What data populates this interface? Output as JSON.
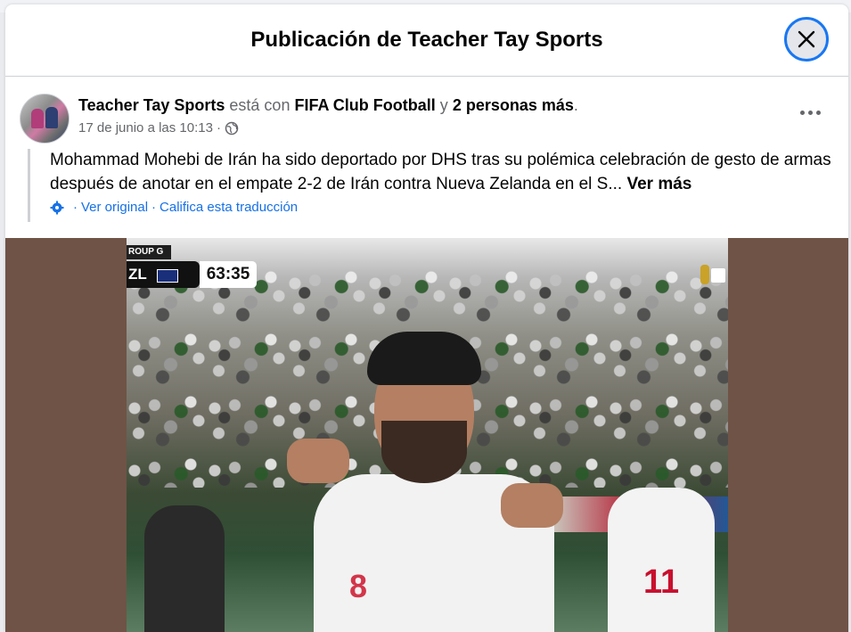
{
  "dialog": {
    "title": "Publicación de Teacher Tay Sports",
    "close_icon": "close-icon"
  },
  "post": {
    "author": "Teacher Tay Sports",
    "with_text": "está con",
    "tagged_page": "FIFA Club Football",
    "and_text": "y",
    "others": "2 personas más",
    "period": ".",
    "timestamp": "17 de junio a las 10:13",
    "separator": "·",
    "privacy_icon": "globe-icon",
    "more_icon": "more-options-icon",
    "caption": "Mohammad Mohebi de Irán ha sido deportado por DHS tras su polémica celebración de gesto de armas después de anotar en el empate 2-2 de Irán contra Nueva Zelanda en el S...",
    "see_more": "Ver más",
    "translation": {
      "icon": "settings-gear-icon",
      "sep": "·",
      "see_original": "Ver original",
      "rate": "Califica esta traducción"
    }
  },
  "media": {
    "scorebug": {
      "group": "ROUP G",
      "team": "ZL",
      "clock": "63:35"
    },
    "jersey_number_main": "8",
    "jersey_number_bg": "11",
    "colors": {
      "frame_bg": "#6f5346",
      "accent": "#1877f2",
      "link": "#1771e6"
    }
  }
}
